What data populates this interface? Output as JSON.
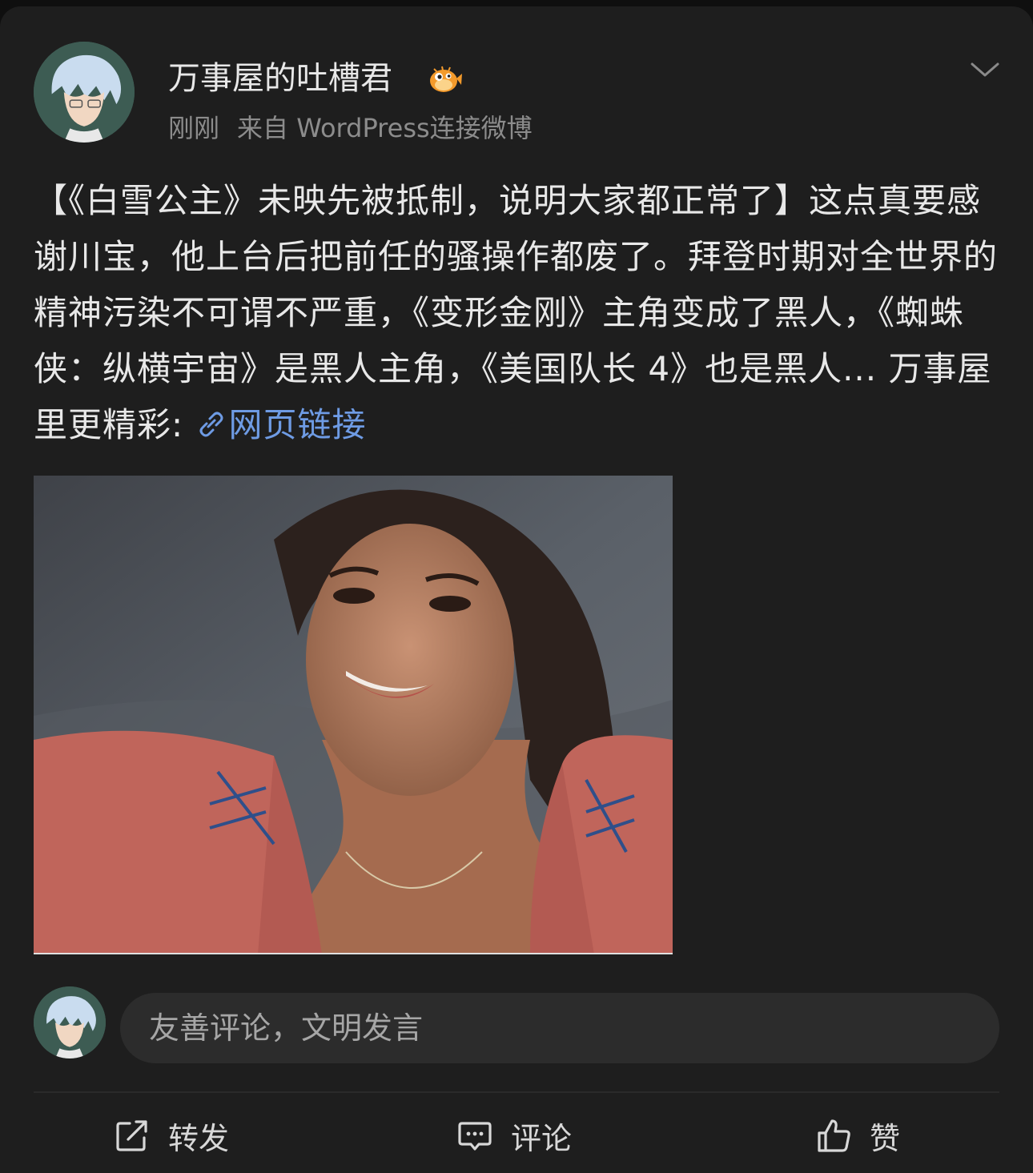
{
  "author": {
    "name": "万事屋的吐槽君",
    "badge_icon": "pufferfish-badge-icon"
  },
  "meta": {
    "time": "刚刚",
    "source": "来自 WordPress连接微博"
  },
  "post": {
    "text": "【《白雪公主》未映先被抵制，说明大家都正常了】这点真要感谢川宝，他上台后把前任的骚操作都废了。拜登时期对全世界的精神污染不可谓不严重，《变形金刚》主角变成了黑人，《蜘蛛侠：纵横宇宙》是黑人主角，《美国队长 4》也是黑人... 万事屋里更精彩: ",
    "link_label": "网页链接",
    "link_icon": "chain-link-icon"
  },
  "comment": {
    "placeholder": "友善评论，文明发言"
  },
  "actions": {
    "repost": "转发",
    "comment": "评论",
    "like": "赞"
  },
  "colors": {
    "background": "#1e1e1e",
    "link": "#6e9be4",
    "secondary_text": "#8c8c8c"
  }
}
